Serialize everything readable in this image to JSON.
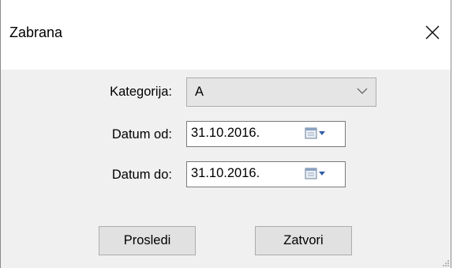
{
  "window": {
    "title": "Zabrana"
  },
  "form": {
    "kategorija": {
      "label": "Kategorija:",
      "value": "A"
    },
    "datum_od": {
      "label": "Datum od:",
      "value": "31.10.2016."
    },
    "datum_do": {
      "label": "Datum do:",
      "value": "31.10.2016."
    }
  },
  "buttons": {
    "prosledi": "Prosledi",
    "zatvori": "Zatvori"
  },
  "icons": {
    "close": "close-icon",
    "dropdown": "chevron-down-icon",
    "calendar": "calendar-icon"
  },
  "colors": {
    "client_bg": "#f0f0f0",
    "titlebar_bg": "#ffffff",
    "button_bg": "#e1e1e1",
    "border": "#adadad"
  }
}
